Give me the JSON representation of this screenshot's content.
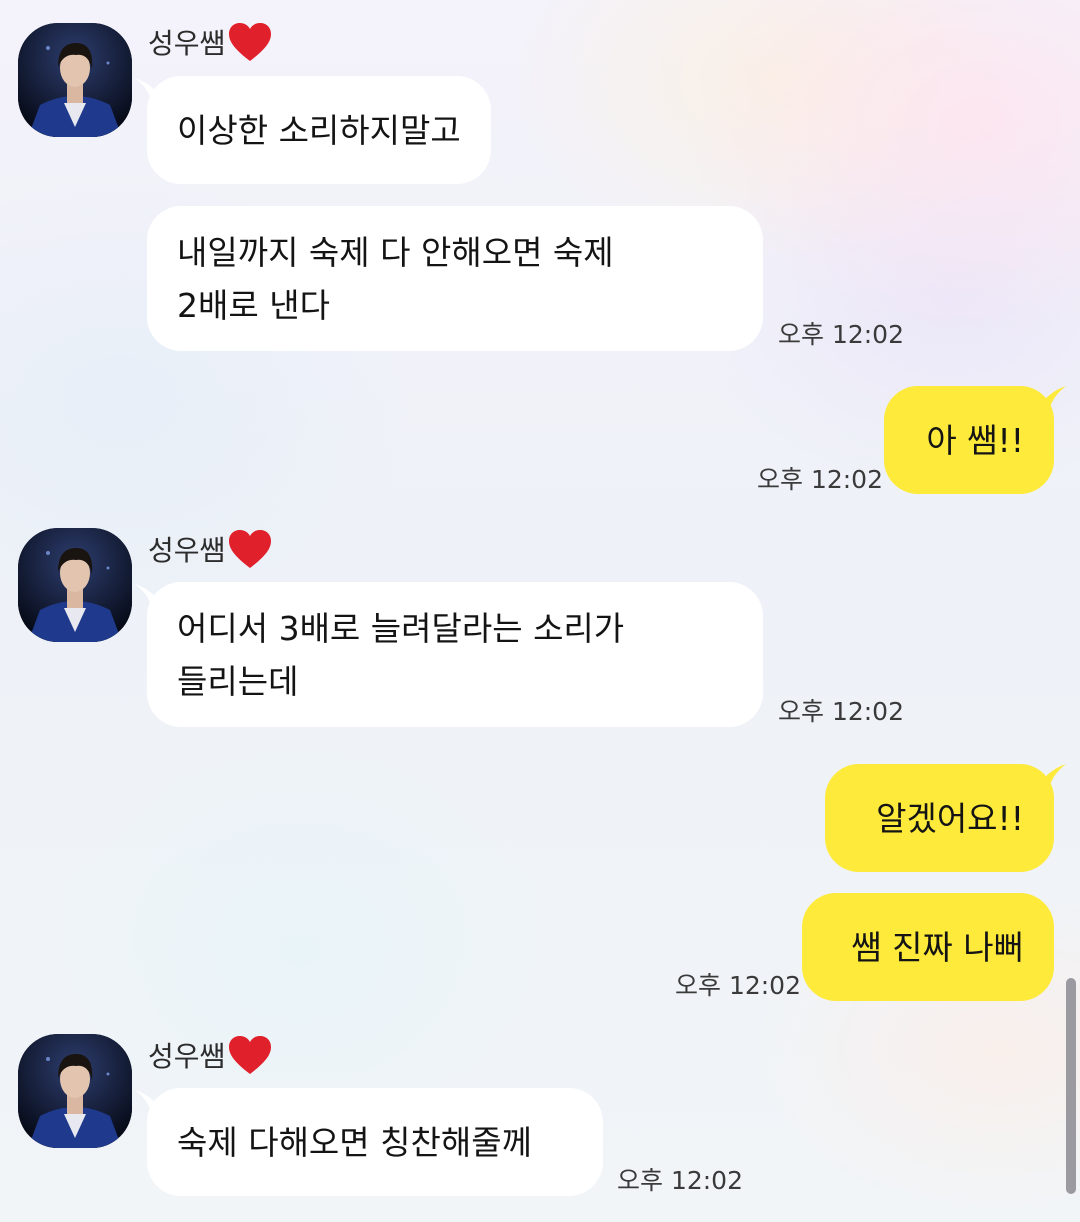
{
  "chat": {
    "sender_name": "성우쌤",
    "time_label": "오후 12:02",
    "messages": [
      {
        "side": "in",
        "lines": [
          "이상한 소리하지말고"
        ]
      },
      {
        "side": "in",
        "lines": [
          "내일까지 숙제 다 안해오면 숙제",
          "2배로 낸다"
        ]
      },
      {
        "side": "out",
        "lines": [
          "아 쌤!!"
        ]
      },
      {
        "side": "in",
        "lines": [
          "어디서 3배로 늘려달라는 소리가",
          "들리는데"
        ]
      },
      {
        "side": "out",
        "lines": [
          "알겠어요!!"
        ]
      },
      {
        "side": "out",
        "lines": [
          "쌤 진짜 나뻐"
        ]
      },
      {
        "side": "in",
        "lines": [
          "숙제 다해오면 칭찬해줄께"
        ]
      }
    ]
  },
  "colors": {
    "incoming_bubble": "#ffffff",
    "outgoing_bubble": "#fdea3b",
    "heart": "#e0202a"
  },
  "icons": {
    "heart": "red-heart-icon",
    "avatar": "profile-avatar"
  }
}
